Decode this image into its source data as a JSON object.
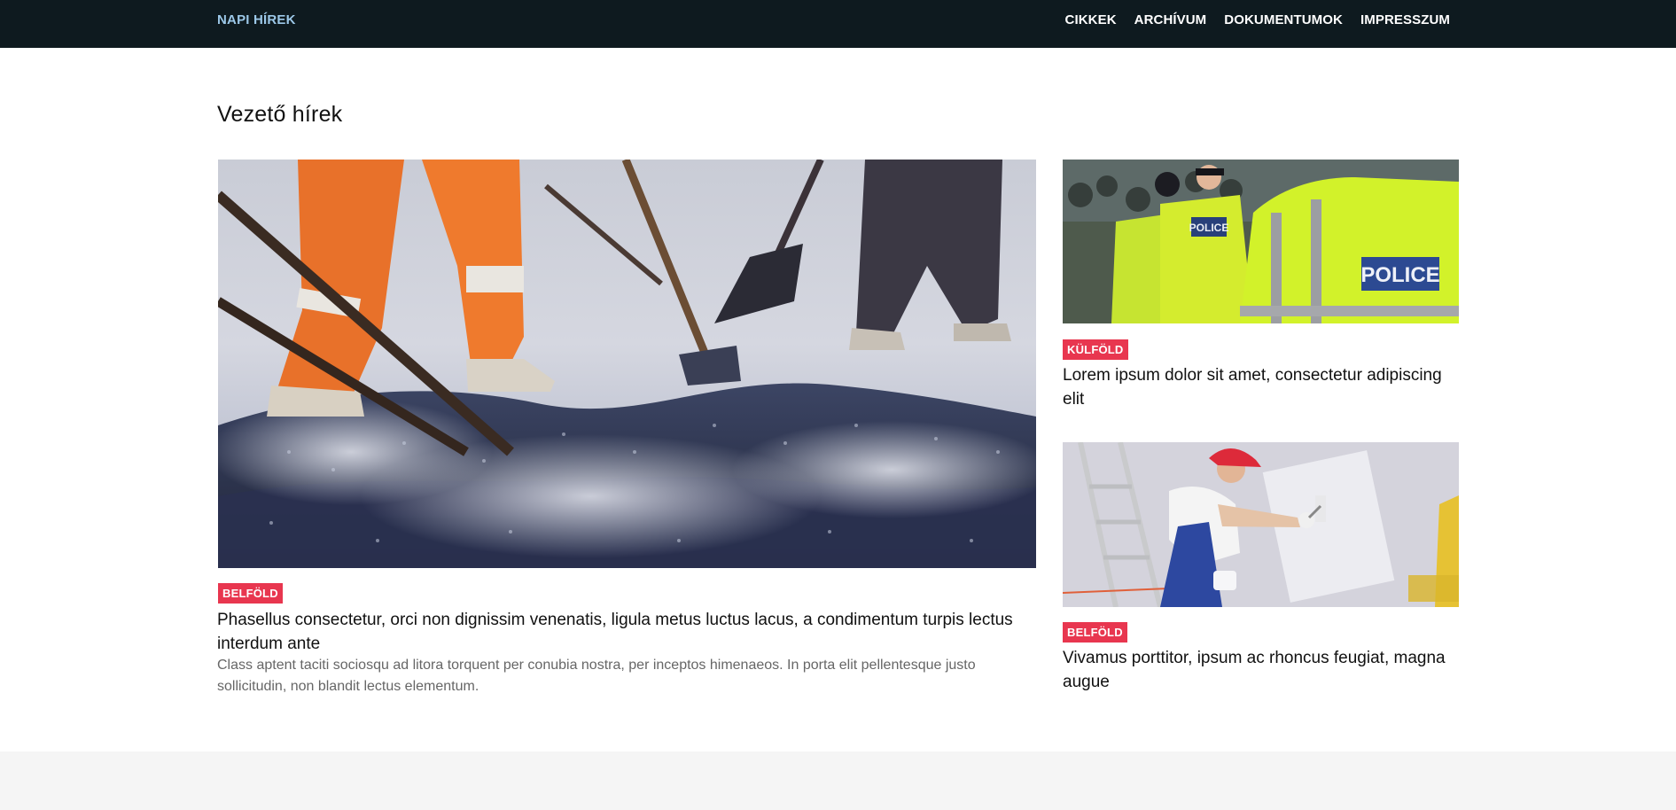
{
  "nav": {
    "brand": "NAPI HÍREK",
    "links": [
      "CIKKEK",
      "ARCHÍVUM",
      "DOKUMENTUMOK",
      "IMPRESSZUM"
    ]
  },
  "section": {
    "title": "Vezető hírek"
  },
  "featured": {
    "category": "BELFÖLD",
    "headline": "Phasellus consectetur, orci non dignissim venenatis, ligula metus luctus lacus, a condimentum turpis lectus interdum ante",
    "excerpt": "Class aptent taciti sociosqu ad litora torquent per conubia nostra, per inceptos himenaeos. In porta elit pellentesque justo sollicitudin, non blandit lectus elementum."
  },
  "side_articles": [
    {
      "category": "KÜLFÖLD",
      "headline": "Lorem ipsum dolor sit amet, consectetur adipiscing elit",
      "image_text": "POLICE"
    },
    {
      "category": "BELFÖLD",
      "headline": "Vivamus porttitor, ipsum ac rhoncus feugiat, magna augue"
    }
  ],
  "colors": {
    "navbar_bg": "#0e1a1f",
    "brand": "#9cc8e8",
    "badge": "#e8364f",
    "footer_bg": "#f5f5f5"
  }
}
